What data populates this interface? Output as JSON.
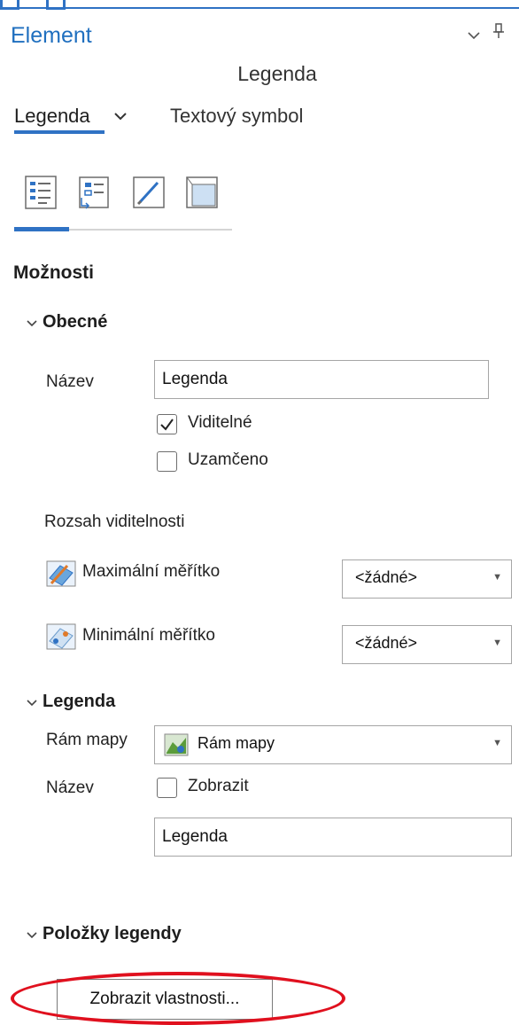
{
  "pane": {
    "title": "Element",
    "collapse_icon": "chevron-down-icon",
    "pin_icon": "pin-icon",
    "element_name": "Legenda"
  },
  "tabs": {
    "primary": "Legenda",
    "secondary": "Textový symbol"
  },
  "icon_tabs": [
    "legend-options-icon",
    "legend-arrange-icon",
    "legend-display-icon",
    "legend-placement-icon"
  ],
  "section_title": "Možnosti",
  "general": {
    "header": "Obecné",
    "name_label": "Název",
    "name_value": "Legenda",
    "visible_label": "Viditelné",
    "visible_checked": true,
    "locked_label": "Uzamčeno",
    "locked_checked": false,
    "visibility_range_label": "Rozsah viditelnosti",
    "max_scale_label": "Maximální měřítko",
    "max_scale_value": "<žádné>",
    "min_scale_label": "Minimální měřítko",
    "min_scale_value": "<žádné>"
  },
  "legend": {
    "header": "Legenda",
    "map_frame_label": "Rám mapy",
    "map_frame_value": "Rám mapy",
    "title_label": "Název",
    "show_label": "Zobrazit",
    "show_checked": false,
    "title_value": "Legenda"
  },
  "legend_items": {
    "header": "Položky legendy",
    "show_properties_button": "Zobrazit vlastnosti..."
  },
  "colors": {
    "accent": "#2f72c4",
    "annotation": "#e0101e"
  }
}
